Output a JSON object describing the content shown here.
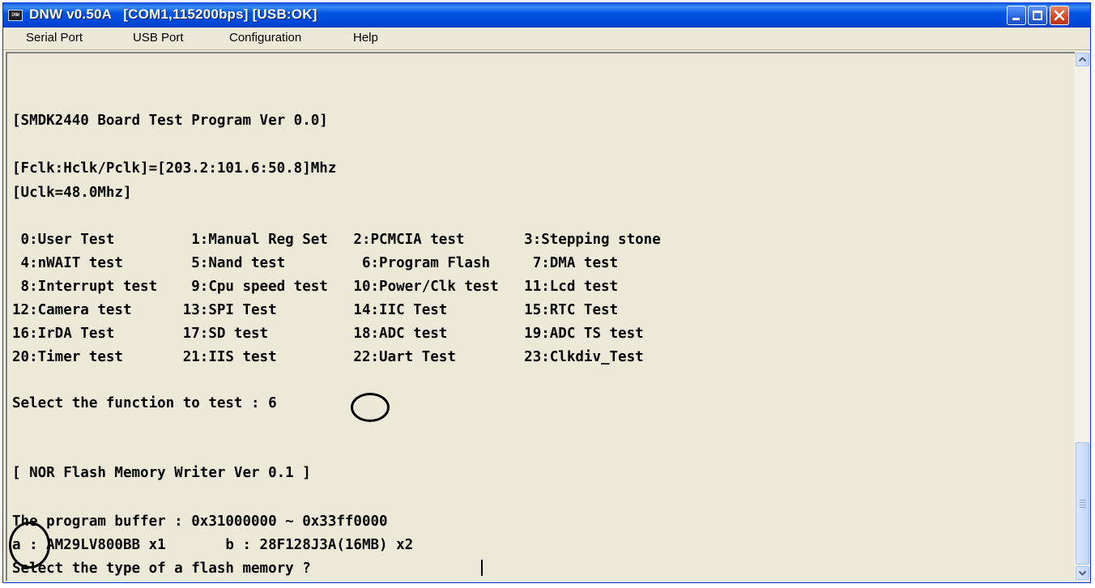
{
  "window": {
    "title": "DNW v0.50A   [COM1,115200bps] [USB:OK]",
    "app_icon": "DNW",
    "buttons": [
      "minimize-icon",
      "maximize-icon",
      "close-icon"
    ]
  },
  "menu": [
    "Serial Port",
    "USB Port",
    "Configuration",
    "Help"
  ],
  "console": {
    "lines": [
      "[SMDK2440 Board Test Program Ver 0.0]",
      "[Fclk:Hclk/Pclk]=[203.2:101.6:50.8]Mhz",
      "[Uclk=48.0Mhz]",
      " 0:User Test         1:Manual Reg Set   2:PCMCIA test       3:Stepping stone",
      " 4:nWAIT test        5:Nand test         6:Program Flash     7:DMA test",
      " 8:Interrupt test    9:Cpu speed test   10:Power/Clk test   11:Lcd test",
      "12:Camera test      13:SPI Test         14:IIC Test         15:RTC Test",
      "16:IrDA Test        17:SD test          18:ADC test         19:ADC TS test",
      "20:Timer test       21:IIS test         22:Uart Test        23:Clkdiv_Test",
      "Select the function to test : 6",
      "[ NOR Flash Memory Writer Ver 0.1 ]",
      "The program buffer : 0x31000000 ~ 0x33ff0000",
      "a : AM29LV800BB x1       b : 28F128J3A(16MB) x2",
      "Select the type of a flash memory ? "
    ]
  },
  "scrollbar": {
    "up_icon": "scroll-up-arrow-icon",
    "down_icon": "scroll-down-arrow-icon"
  }
}
